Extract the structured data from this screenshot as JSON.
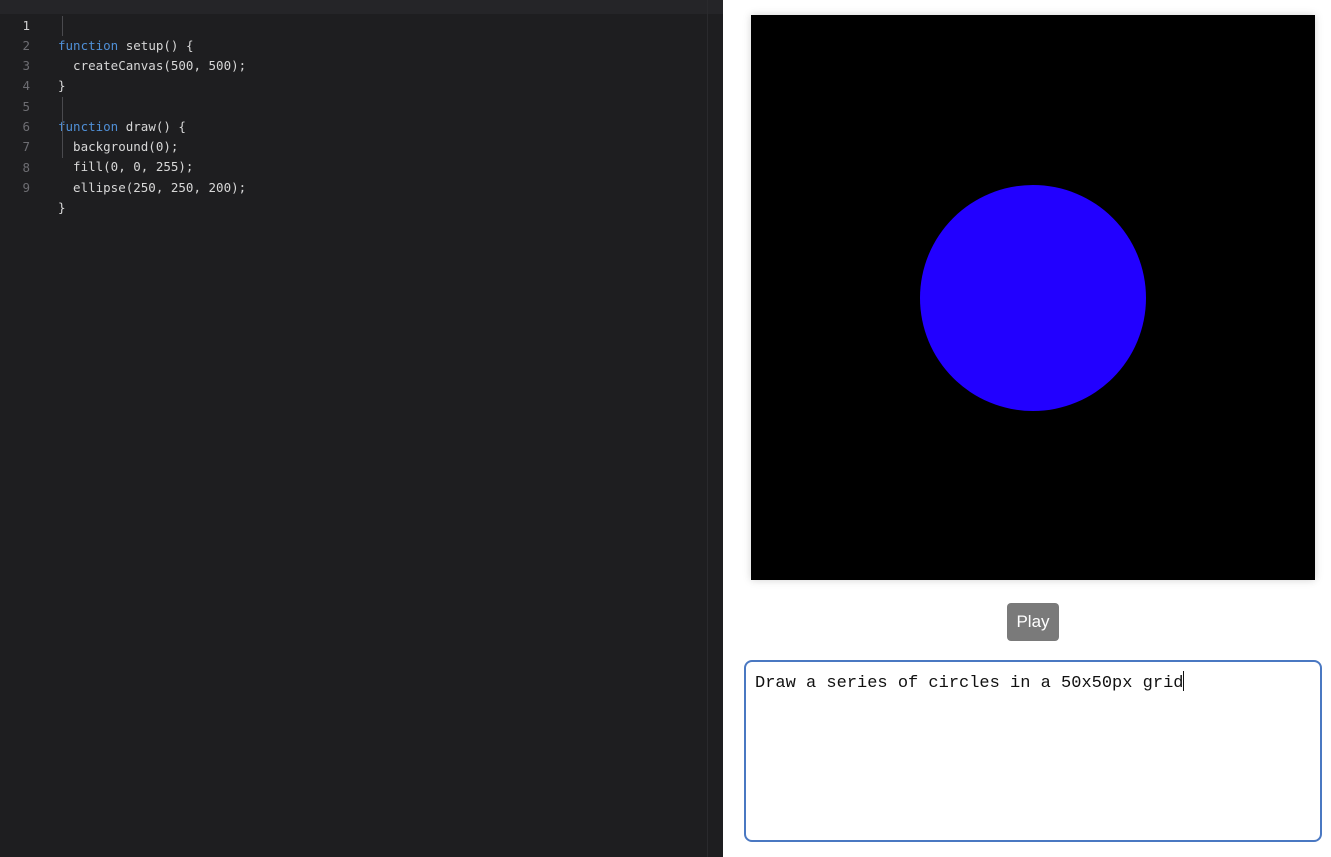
{
  "editor": {
    "lines": [
      {
        "num": "1",
        "keyword": "function",
        "rest": " setup() {"
      },
      {
        "num": "2",
        "keyword": "",
        "rest": "  createCanvas(500, 500);"
      },
      {
        "num": "3",
        "keyword": "",
        "rest": "}"
      },
      {
        "num": "4",
        "keyword": "",
        "rest": ""
      },
      {
        "num": "5",
        "keyword": "function",
        "rest": " draw() {"
      },
      {
        "num": "6",
        "keyword": "",
        "rest": "  background(0);"
      },
      {
        "num": "7",
        "keyword": "",
        "rest": "  fill(0, 0, 255);"
      },
      {
        "num": "8",
        "keyword": "",
        "rest": "  ellipse(250, 250, 200);"
      },
      {
        "num": "9",
        "keyword": "",
        "rest": "}"
      }
    ],
    "current_line": "1"
  },
  "preview": {
    "canvas_background": "#000000",
    "ellipse_fill": "#2200ff",
    "play_label": "Play"
  },
  "prompt": {
    "value": "Draw a series of circles in a 50x50px grid"
  }
}
